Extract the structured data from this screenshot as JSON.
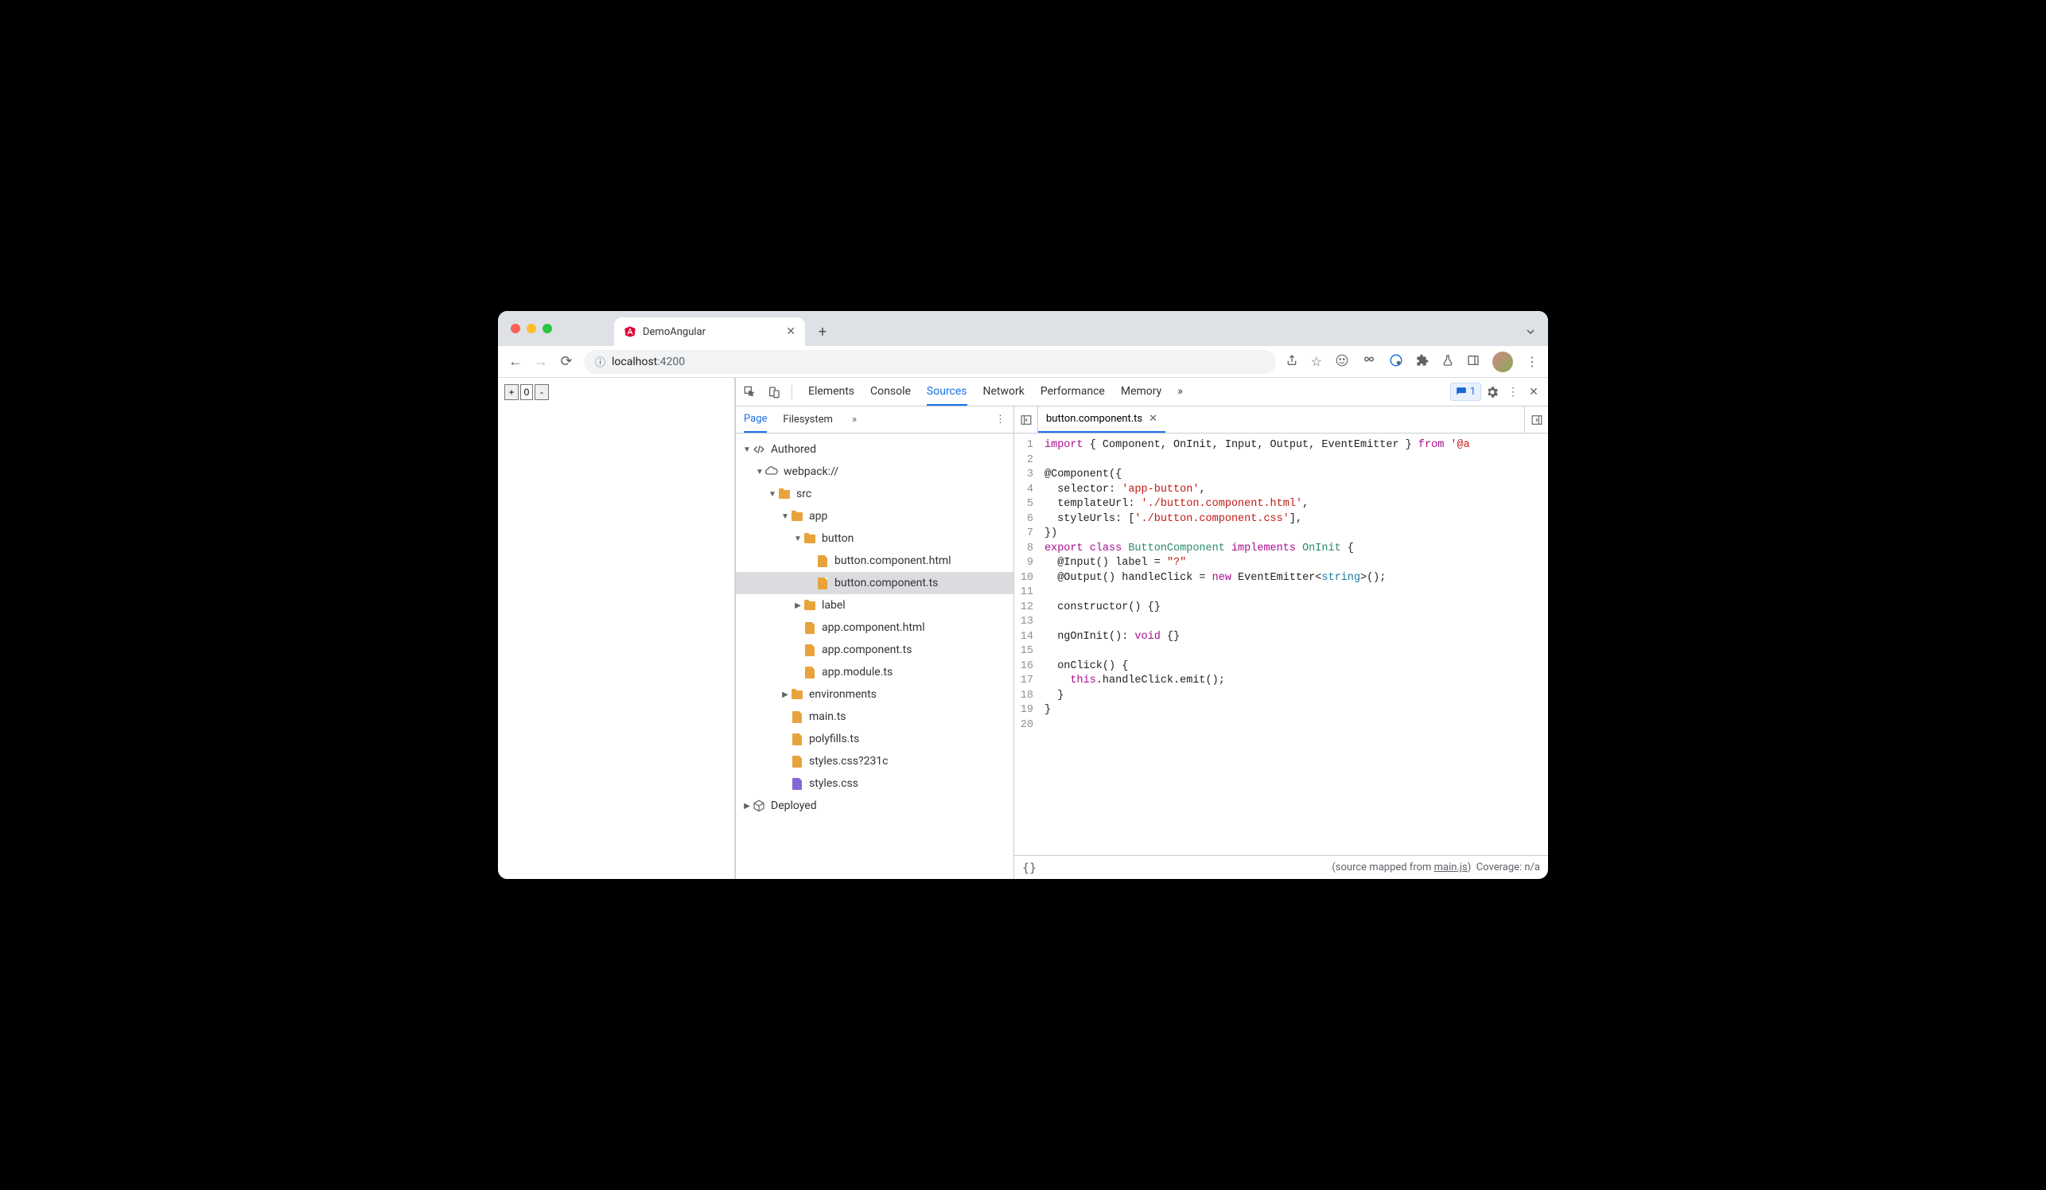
{
  "browser": {
    "tab_title": "DemoAngular",
    "url_host": "localhost",
    "url_port": ":4200"
  },
  "page": {
    "counter_value": "0",
    "plus": "+",
    "minus": "-"
  },
  "devtools": {
    "panels": [
      "Elements",
      "Console",
      "Sources",
      "Network",
      "Performance",
      "Memory"
    ],
    "active_panel": "Sources",
    "issues_count": "1",
    "sidebar_tabs": [
      "Page",
      "Filesystem"
    ],
    "active_sidebar_tab": "Page",
    "tree": {
      "authored": "Authored",
      "webpack": "webpack://",
      "src": "src",
      "app": "app",
      "button": "button",
      "button_html": "button.component.html",
      "button_ts": "button.component.ts",
      "label": "label",
      "app_html": "app.component.html",
      "app_ts": "app.component.ts",
      "app_module": "app.module.ts",
      "environments": "environments",
      "main_ts": "main.ts",
      "polyfills": "polyfills.ts",
      "styles_q": "styles.css?231c",
      "styles": "styles.css",
      "deployed": "Deployed"
    },
    "editor_tab": "button.component.ts",
    "footer_braces": "{}",
    "footer_mapped_prefix": "(source mapped from ",
    "footer_mapped_link": "main.js",
    "footer_mapped_suffix": ")",
    "footer_coverage": "Coverage: n/a"
  },
  "code": {
    "lines": 20,
    "l1_a": "import",
    "l1_b": " { Component, OnInit, Input, Output, EventEmitter } ",
    "l1_c": "from",
    "l1_d": " '@a",
    "l3": "@Component({",
    "l4_a": "  selector: ",
    "l4_b": "'app-button'",
    "l4_c": ",",
    "l5_a": "  templateUrl: ",
    "l5_b": "'./button.component.html'",
    "l5_c": ",",
    "l6_a": "  styleUrls: [",
    "l6_b": "'./button.component.css'",
    "l6_c": "],",
    "l7": "})",
    "l8_a": "export",
    "l8_b": " class",
    "l8_c": " ButtonComponent",
    "l8_d": " implements",
    "l8_e": " OnInit",
    "l8_f": " {",
    "l9_a": "  @Input() label = ",
    "l9_b": "\"?\"",
    "l10_a": "  @Output() handleClick = ",
    "l10_b": "new",
    "l10_c": " EventEmitter<",
    "l10_d": "string",
    "l10_e": ">();",
    "l12": "  constructor() {}",
    "l14_a": "  ngOnInit(): ",
    "l14_b": "void",
    "l14_c": " {}",
    "l16": "  onClick() {",
    "l17_a": "    ",
    "l17_b": "this",
    "l17_c": ".handleClick.emit();",
    "l18": "  }",
    "l19": "}"
  }
}
